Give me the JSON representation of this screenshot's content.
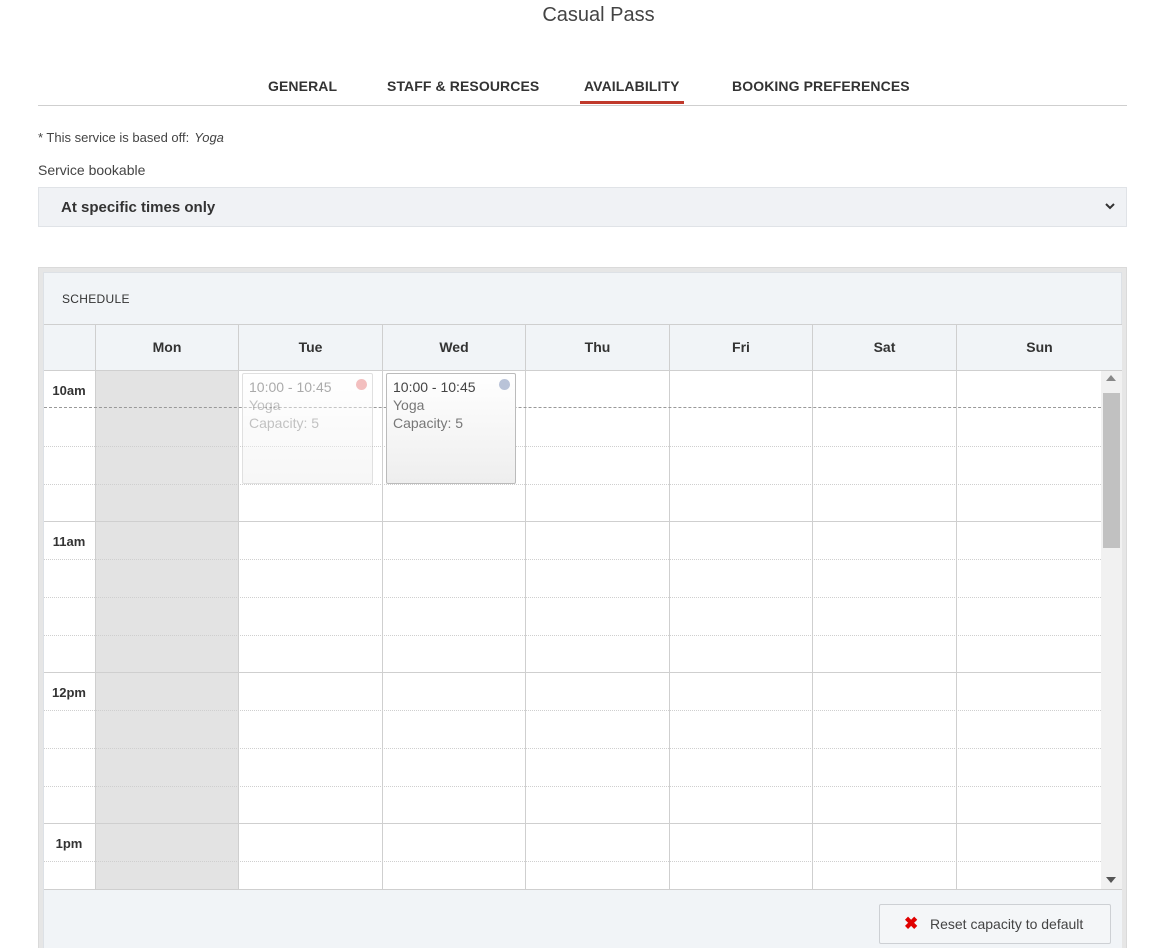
{
  "page": {
    "title": "Casual Pass"
  },
  "tabs": [
    {
      "label": "GENERAL",
      "active": false
    },
    {
      "label": "STAFF & RESOURCES",
      "active": false
    },
    {
      "label": "AVAILABILITY",
      "active": true
    },
    {
      "label": "BOOKING PREFERENCES",
      "active": false
    }
  ],
  "service_note": {
    "prefix": "* This service is based off:",
    "service": "Yoga"
  },
  "bookable": {
    "label": "Service bookable",
    "selected": "At specific times only",
    "icon": "chevron-down-icon"
  },
  "schedule": {
    "heading": "SCHEDULE",
    "days": [
      "Mon",
      "Tue",
      "Wed",
      "Thu",
      "Fri",
      "Sat",
      "Sun"
    ],
    "disabled_days": [
      "Mon"
    ],
    "times": [
      "10am",
      "11am",
      "12pm",
      "1pm"
    ],
    "events": [
      {
        "day": "Tue",
        "time": "10:00 - 10:45",
        "name": "Yoga",
        "capacity": "Capacity: 5",
        "dot_color": "#e57373",
        "faded": true
      },
      {
        "day": "Wed",
        "time": "10:00 - 10:45",
        "name": "Yoga",
        "capacity": "Capacity: 5",
        "dot_color": "#b9c3d8",
        "faded": false
      }
    ],
    "reset_button": {
      "label": "Reset capacity to default",
      "icon": "close-icon",
      "icon_color": "#e00000"
    }
  },
  "colors": {
    "accent": "#c0392b",
    "disabled_day": "#e3e3e3",
    "panel_bg": "#f1f4f7"
  }
}
